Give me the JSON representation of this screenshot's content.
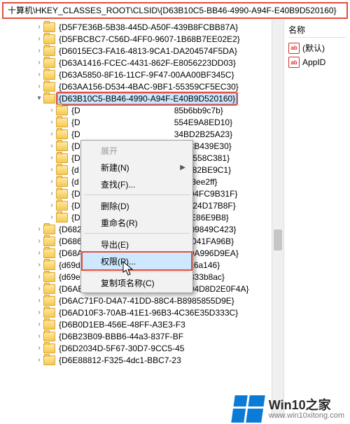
{
  "address_bar": "十算机\\HKEY_CLASSES_ROOT\\CLSID\\{D63B10C5-BB46-4990-A94F-E40B9D520160}",
  "right_panel": {
    "column_header": "名称",
    "rows": [
      {
        "icon": "ab",
        "label": "(默认)"
      },
      {
        "icon": "ab",
        "label": "AppID"
      }
    ]
  },
  "selected_key": "{D63B10C5-BB46-4990-A94F-E40B9D520160}",
  "tree": [
    {
      "d": 0,
      "exp": "closed",
      "text": "{D5F7E36B-5B38-445D-A50F-439B8FCBB87A}"
    },
    {
      "d": 0,
      "exp": "closed",
      "text": "{D5FBCBC7-C56D-4FF0-9607-1B68B7EE02E2}"
    },
    {
      "d": 0,
      "exp": "closed",
      "text": "{D6015EC3-FA16-4813-9CA1-DA204574F5DA}"
    },
    {
      "d": 0,
      "exp": "closed",
      "text": "{D63A1416-FCEC-4431-862F-E8056223DD03}"
    },
    {
      "d": 0,
      "exp": "closed",
      "text": "{D63A5850-8F16-11CF-9F47-00AA00BF345C}"
    },
    {
      "d": 0,
      "exp": "closed",
      "text": "{D63AA156-D534-4BAC-9BF1-55359CF5EC30}"
    },
    {
      "d": 0,
      "exp": "open",
      "text": "{D63B10C5-BB46-4990-A94F-E40B9D520160}",
      "sel": true,
      "red": true
    },
    {
      "d": 1,
      "exp": "closed",
      "text": "{D",
      "tail": "85b6bb9c7b}"
    },
    {
      "d": 1,
      "exp": "closed",
      "text": "{D",
      "tail": "554E9A8ED10}"
    },
    {
      "d": 1,
      "exp": "closed",
      "text": "{D",
      "tail": "34BD2B25A23}"
    },
    {
      "d": 1,
      "exp": "closed",
      "text": "{D",
      "tail": "301CB439E30}"
    },
    {
      "d": 1,
      "exp": "closed",
      "text": "{D",
      "tail": "3733558C381}"
    },
    {
      "d": 1,
      "exp": "closed",
      "text": "{d",
      "tail": "A85382BE9C1}"
    },
    {
      "d": 1,
      "exp": "closed",
      "text": "{d",
      "tail": "90743ee2ff}"
    },
    {
      "d": 1,
      "exp": "closed",
      "text": "{D",
      "tail": "00C04FC9B31F}"
    },
    {
      "d": 1,
      "exp": "closed",
      "text": "{D",
      "tail": "268524D17B8F}"
    },
    {
      "d": 1,
      "exp": "closed",
      "text": "{D",
      "tail": "ED8E86E9B8}"
    },
    {
      "d": 0,
      "exp": "closed",
      "text": "{D682C4BA-A90A-42FE-B9E1-03109849C423}"
    },
    {
      "d": 0,
      "exp": "closed",
      "text": "{D686B603-9D2F-4EB2-B667-1971041FA96B}"
    },
    {
      "d": 0,
      "exp": "closed",
      "text": "{D68AF00A-29CB-43FA-8504-CE99A996D9EA}"
    },
    {
      "d": 0,
      "exp": "closed",
      "text": "{d69df9c0-ded9-4290-958f-93e82ea6a146}"
    },
    {
      "d": 0,
      "exp": "closed",
      "text": "{d69e0717-dd4b-4b25-997a-da813833b8ac}"
    },
    {
      "d": 0,
      "exp": "closed",
      "text": "{D6ABE021-1DE0-49F4-895D-E9694D8D2E0F4A}"
    },
    {
      "d": 0,
      "exp": "closed",
      "text": "{D6AC71F0-D4A7-41DD-88C4-B8985855D9E}"
    },
    {
      "d": 0,
      "exp": "closed",
      "text": "{D6AD10F3-70AB-41E1-96B3-4C36E35D333C}"
    },
    {
      "d": 0,
      "exp": "closed",
      "text": "{D6B0D1EB-456E-48FF-A3E3-F3"
    },
    {
      "d": 0,
      "exp": "closed",
      "text": "{D6B23B09-BBB6-44a3-837F-BF"
    },
    {
      "d": 0,
      "exp": "closed",
      "text": "{D6D2034D-5F67-30D7-9CC5-45"
    },
    {
      "d": 0,
      "exp": "closed",
      "text": "{D6E88812-F325-4dc1-BBC7-23"
    }
  ],
  "context_menu": {
    "items": [
      {
        "label": "展开",
        "enabled": false
      },
      {
        "label": "新建(N)",
        "enabled": true,
        "submenu": true
      },
      {
        "label": "查找(F)...",
        "enabled": true
      },
      {
        "sep": true
      },
      {
        "label": "删除(D)",
        "enabled": true
      },
      {
        "label": "重命名(R)",
        "enabled": true
      },
      {
        "sep": true
      },
      {
        "label": "导出(E)",
        "enabled": true
      },
      {
        "label": "权限(P)...",
        "enabled": true,
        "highlight": true,
        "red": true
      },
      {
        "sep": true
      },
      {
        "label": "复制项名称(C)",
        "enabled": true
      }
    ]
  },
  "watermark": {
    "title": "Win10之家",
    "url": "www.win10xitong.com"
  }
}
